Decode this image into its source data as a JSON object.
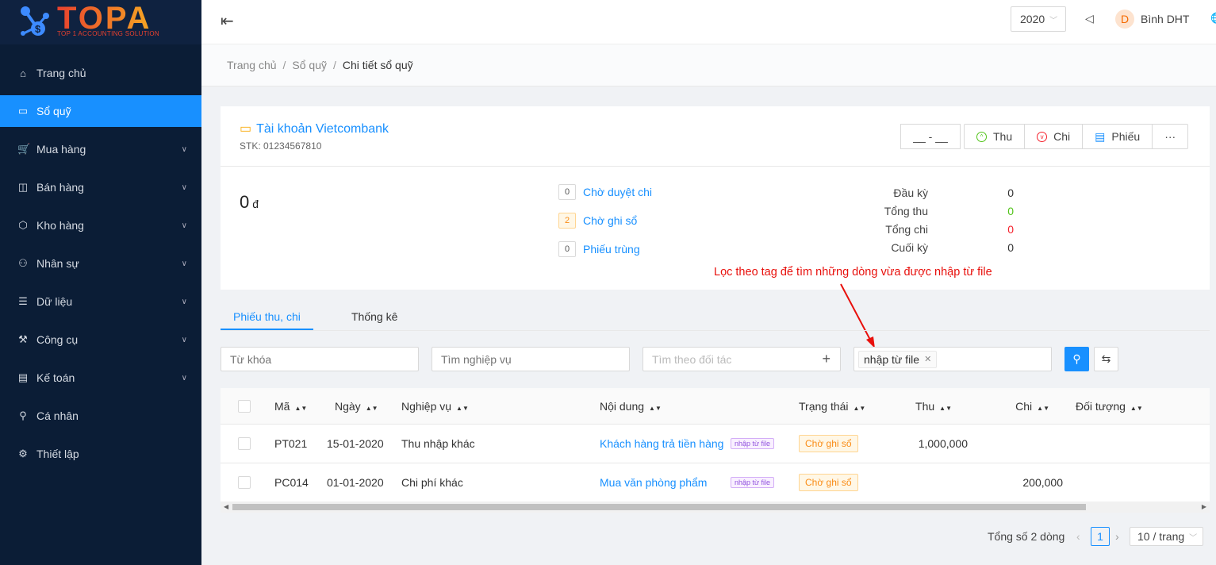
{
  "brand": {
    "name": "TOPA",
    "tagline": "TOP 1 ACCOUNTING SOLUTION"
  },
  "sidebar": {
    "items": [
      {
        "label": "Trang chủ",
        "icon": "home-icon",
        "glyph": "⌂",
        "expandable": false,
        "active": false
      },
      {
        "label": "Sổ quỹ",
        "icon": "wallet-icon",
        "glyph": "▭",
        "expandable": false,
        "active": true
      },
      {
        "label": "Mua hàng",
        "icon": "cart-icon",
        "glyph": "🛒",
        "expandable": true,
        "active": false
      },
      {
        "label": "Bán hàng",
        "icon": "shopping-bag-icon",
        "glyph": "◫",
        "expandable": true,
        "active": false
      },
      {
        "label": "Kho hàng",
        "icon": "box-icon",
        "glyph": "⬡",
        "expandable": true,
        "active": false
      },
      {
        "label": "Nhân sự",
        "icon": "team-icon",
        "glyph": "⚇",
        "expandable": true,
        "active": false
      },
      {
        "label": "Dữ liệu",
        "icon": "database-icon",
        "glyph": "☰",
        "expandable": true,
        "active": false
      },
      {
        "label": "Công cụ",
        "icon": "tool-icon",
        "glyph": "⚒",
        "expandable": true,
        "active": false
      },
      {
        "label": "Kế toán",
        "icon": "book-icon",
        "glyph": "▤",
        "expandable": true,
        "active": false
      },
      {
        "label": "Cá nhân",
        "icon": "user-icon",
        "glyph": "⚲",
        "expandable": false,
        "active": false
      },
      {
        "label": "Thiết lập",
        "icon": "setting-icon",
        "glyph": "⚙",
        "expandable": false,
        "active": false
      }
    ]
  },
  "header": {
    "year": "2020",
    "user_initial": "D",
    "user_name": "Bình DHT"
  },
  "breadcrumb": [
    "Trang chủ",
    "Sổ quỹ",
    "Chi tiết sổ quỹ"
  ],
  "account": {
    "name": "Tài khoản Vietcombank",
    "stk": "STK: 01234567810",
    "balance": "0",
    "currency": "đ"
  },
  "actions": {
    "date_range": "__ - __",
    "thu": "Thu",
    "chi": "Chi",
    "phieu": "Phiếu",
    "more": "···"
  },
  "pending": [
    {
      "count": "0",
      "label": "Chờ duyệt chi"
    },
    {
      "count": "2",
      "label": "Chờ ghi sổ"
    },
    {
      "count": "0",
      "label": "Phiếu trùng"
    }
  ],
  "summary": [
    {
      "label": "Đầu kỳ",
      "value": "0",
      "color": "#333333"
    },
    {
      "label": "Tổng thu",
      "value": "0",
      "color": "#52c41a"
    },
    {
      "label": "Tổng chi",
      "value": "0",
      "color": "#f5222d"
    },
    {
      "label": "Cuối kỳ",
      "value": "0",
      "color": "#333333"
    }
  ],
  "annotation": "Lọc theo tag để tìm những dòng vừa được nhập từ file",
  "tabs": [
    "Phiếu thu, chi",
    "Thống kê"
  ],
  "filters": {
    "keyword_placeholder": "Từ khóa",
    "operation_placeholder": "Tìm nghiệp vụ",
    "partner_placeholder": "Tìm theo đối tác",
    "tag_value": "nhập từ file"
  },
  "table": {
    "columns": [
      "Mã",
      "Ngày",
      "Nghiệp vụ",
      "Nội dung",
      "Trạng thái",
      "Thu",
      "Chi",
      "Đối tượng"
    ],
    "rows": [
      {
        "code": "PT021",
        "date": "15-01-2020",
        "operation": "Thu nhập khác",
        "content": "Khách hàng trả tiền hàng",
        "tag": "nhập từ file",
        "status": "Chờ ghi sổ",
        "thu": "1,000,000",
        "chi": ""
      },
      {
        "code": "PC014",
        "date": "01-01-2020",
        "operation": "Chi phí khác",
        "content": "Mua văn phòng phẩm",
        "tag": "nhập từ file",
        "status": "Chờ ghi sổ",
        "thu": "",
        "chi": "200,000"
      }
    ]
  },
  "pagination": {
    "total": "Tổng số 2 dòng",
    "current": "1",
    "page_size": "10 / trang"
  },
  "colors": {
    "primary": "#1890ff",
    "sidebar": "#0b1d36",
    "annotation": "#e8100c"
  }
}
